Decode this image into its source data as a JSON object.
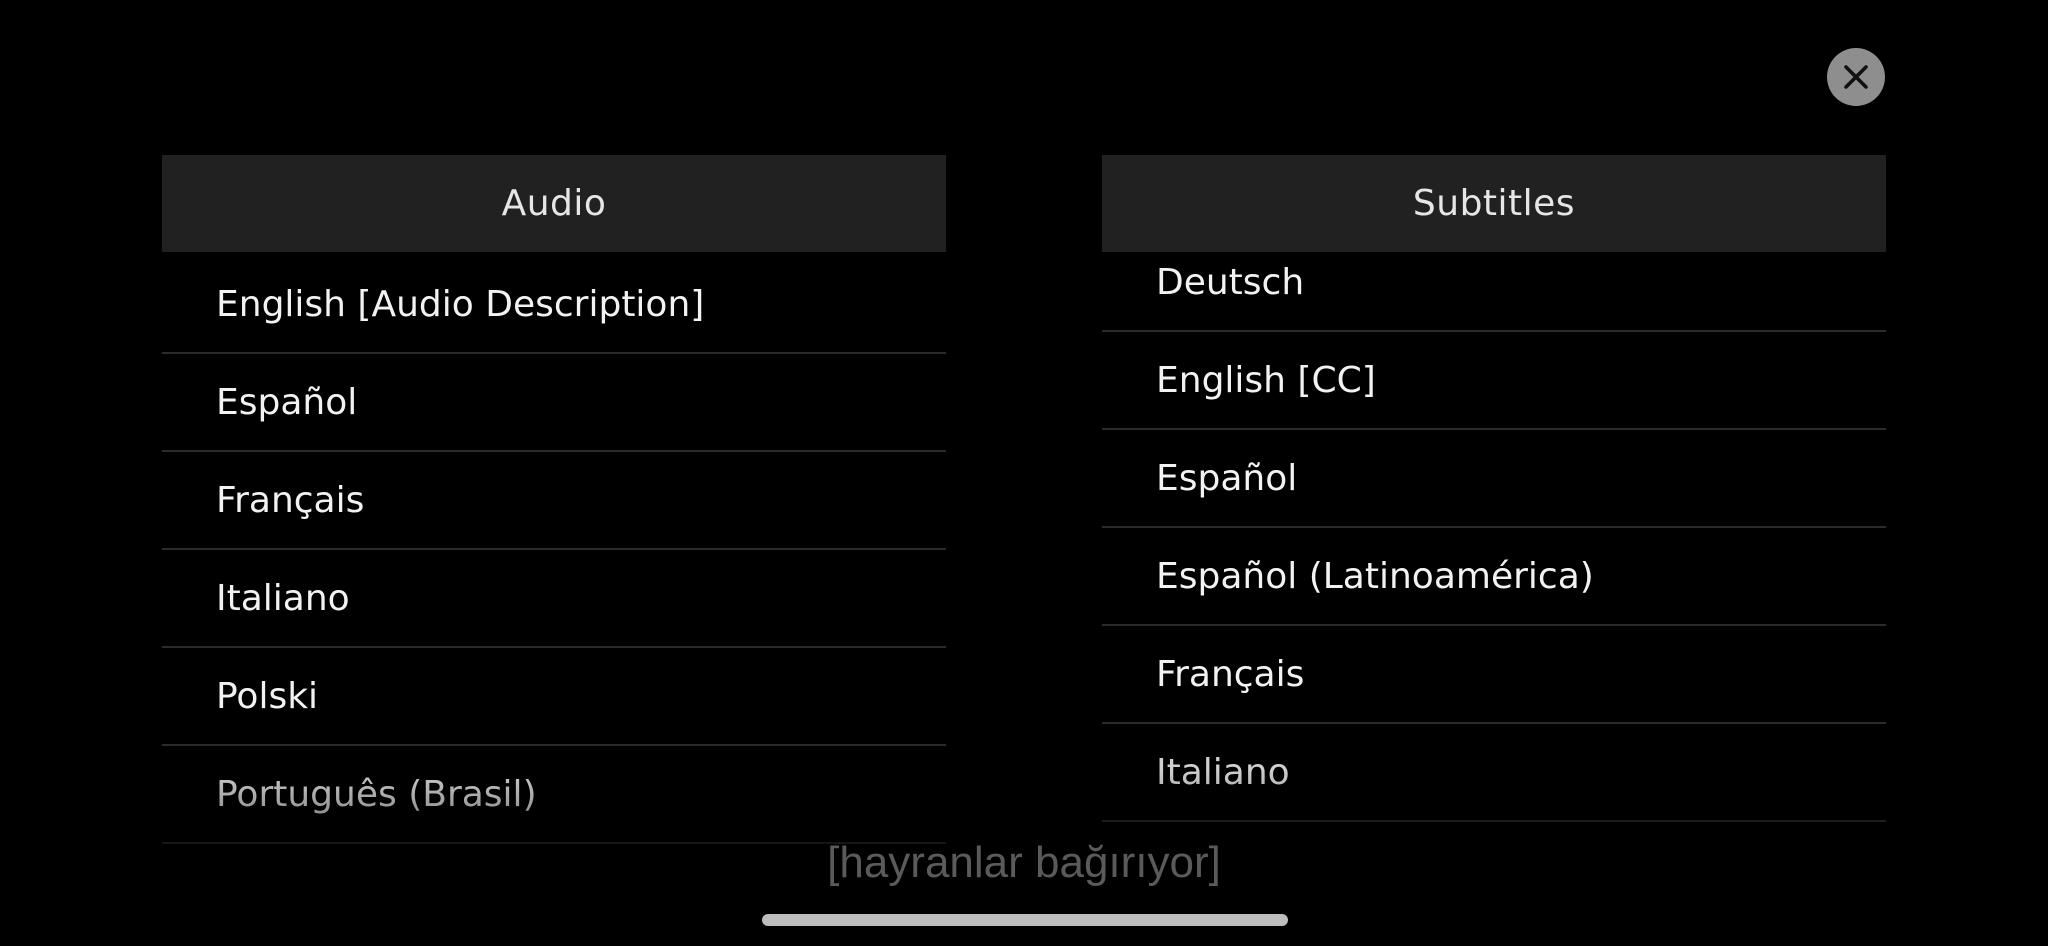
{
  "close_button": {
    "icon": "close-icon"
  },
  "audio": {
    "header": "Audio",
    "items": [
      "English [Audio Description]",
      "Español",
      "Français",
      "Italiano",
      "Polski",
      "Português (Brasil)"
    ]
  },
  "subtitles": {
    "header": "Subtitles",
    "items": [
      "Deutsch",
      "English [CC]",
      "Español",
      "Español (Latinoamérica)",
      "Français",
      "Italiano"
    ]
  },
  "caption": "[hayranlar bağırıyor]",
  "colors": {
    "background": "#000000",
    "header_bg": "#212121",
    "divider": "#2b2b2b",
    "close_button_bg": "#8e8e8e"
  }
}
